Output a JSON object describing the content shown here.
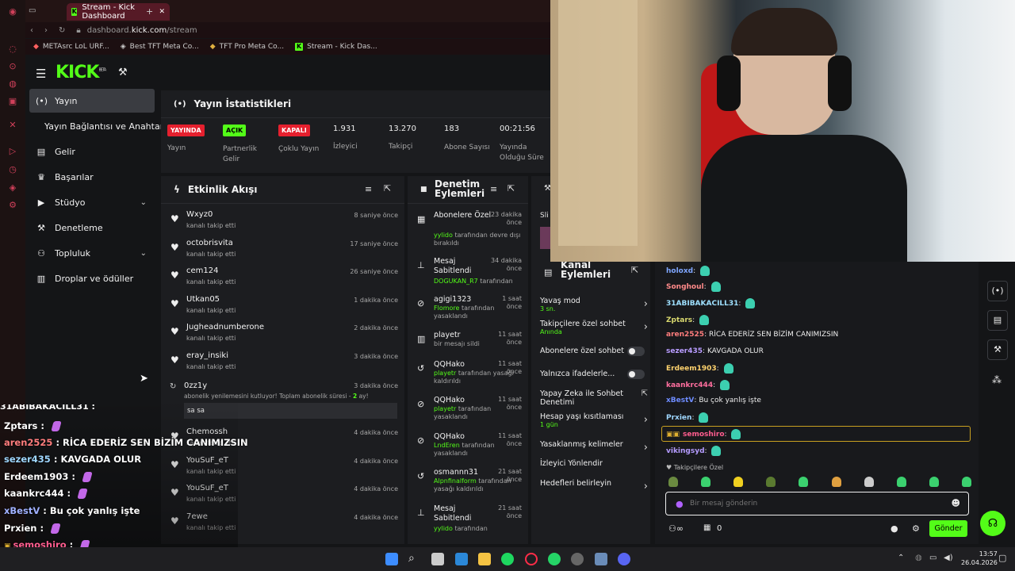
{
  "browser": {
    "tab_title": "Stream - Kick Dashboard",
    "url_prefix": "dashboard.",
    "url_host": "kick.com",
    "url_path": "/stream",
    "bookmarks": [
      "METAsrc LoL URF...",
      "Best TFT Meta Co...",
      "TFT Pro Meta Co...",
      "Stream - Kick Das..."
    ]
  },
  "header": {
    "logo": "KICK",
    "beta": "BETA"
  },
  "sidebar": {
    "items": [
      {
        "label": "Yayın",
        "icon": "broadcast-icon"
      },
      {
        "label": "Yayın Bağlantısı ve Anahtarı",
        "icon": ""
      },
      {
        "label": "Gelir",
        "icon": "coins-icon"
      },
      {
        "label": "Başarılar",
        "icon": "trophy-icon"
      },
      {
        "label": "Stüdyo",
        "icon": "camera-icon"
      },
      {
        "label": "Denetleme",
        "icon": "hammer-icon"
      },
      {
        "label": "Topluluk",
        "icon": "people-icon"
      },
      {
        "label": "Droplar ve ödüller",
        "icon": "drops-icon"
      }
    ]
  },
  "stats": {
    "title": "Yayın İstatistikleri",
    "items": [
      {
        "badge": "YAYINDA",
        "label": "Yayın"
      },
      {
        "badge": "AÇIK",
        "label": "Partnerlik Gelir Programı"
      },
      {
        "badge": "KAPALI",
        "label": "Çoklu Yayın"
      },
      {
        "value": "1.931",
        "label": "İzleyici"
      },
      {
        "value": "13.270",
        "label": "Takipçi"
      },
      {
        "value": "183",
        "label": "Abone Sayısı"
      },
      {
        "value": "00:21:56",
        "label": "Yayında Olduğu Süre"
      }
    ]
  },
  "activity": {
    "title": "Etkinlik Akışı",
    "events": [
      {
        "user": "Wxyz0",
        "sub": "kanalı takip etti",
        "time": "8 saniye önce"
      },
      {
        "user": "octobrisvita",
        "sub": "kanalı takip etti",
        "time": "17 saniye önce"
      },
      {
        "user": "cem124",
        "sub": "kanalı takip etti",
        "time": "26 saniye önce"
      },
      {
        "user": "Utkan05",
        "sub": "kanalı takip etti",
        "time": "1 dakika önce"
      },
      {
        "user": "Jugheadnumberone",
        "sub": "kanalı takip etti",
        "time": "2 dakika önce"
      },
      {
        "user": "eray_insiki",
        "sub": "kanalı takip etti",
        "time": "3 dakika önce"
      },
      {
        "user": "Chemossh",
        "sub": "kanalı takip etti",
        "time": "4 dakika önce"
      },
      {
        "user": "YouSuF_eT",
        "sub": "kanalı takip etti",
        "time": "4 dakika önce"
      },
      {
        "user": "YouSuF_eT",
        "sub": "kanalı takip etti",
        "time": "4 dakika önce"
      },
      {
        "user": "7ewe",
        "sub": "kanalı takip etti",
        "time": "4 dakika önce"
      }
    ],
    "sub_event": {
      "user": "0zz1y",
      "text_before": "abonelik yenilemesini kutluyor! Toplam abonelik süresi - ",
      "months": "2",
      "text_after": " ay!",
      "time": "3 dakika önce",
      "message": "sa sa"
    }
  },
  "moderation": {
    "title": "Denetim Eylemleri",
    "actions": [
      {
        "action": "Abonelere Özel",
        "name": "yylido",
        "detail": "tarafından devre dışı bırakıldı",
        "time": "23 dakika önce"
      },
      {
        "action": "Mesaj Sabitlendi",
        "name": "DOGUKAN_R7",
        "detail": "tarafından",
        "time": "34 dakika önce"
      },
      {
        "action": "agigi1323",
        "name": "Flomore",
        "detail": "tarafından yasaklandı",
        "time": "1 saat önce"
      },
      {
        "action": "playetr",
        "name": "",
        "detail": "bir mesajı sildi",
        "time": "11 saat önce"
      },
      {
        "action": "QQHako",
        "name": "playetr",
        "detail": "tarafından yasağı kaldırıldı",
        "time": "11 saat önce"
      },
      {
        "action": "QQHako",
        "name": "playetr",
        "detail": "tarafından yasaklandı",
        "time": "11 saat önce"
      },
      {
        "action": "QQHako",
        "name": "LndEren",
        "detail": "tarafından yasaklandı",
        "time": "11 saat önce"
      },
      {
        "action": "osmannn31",
        "name": "Alpnfinalform",
        "detail": "tarafından yasağı kaldırıldı",
        "time": "21 saat önce"
      },
      {
        "action": "Mesaj Sabitlendi",
        "name": "yylido",
        "detail": "tarafından",
        "time": "21 saat önce"
      }
    ]
  },
  "channel_actions": {
    "title": "Kanal Eylemleri",
    "items": [
      {
        "label": "Yavaş mod",
        "sub": "3 sn."
      },
      {
        "label": "Takipçilere özel sohbet",
        "sub": "Anında"
      },
      {
        "label": "Abonelere özel sohbet",
        "sub": ""
      },
      {
        "label": "Yalnızca ifadelerle...",
        "sub": ""
      },
      {
        "label": "Yapay Zeka ile Sohbet Denetimi",
        "sub": ""
      },
      {
        "label": "Hesap yaşı kısıtlaması",
        "sub": "1 gün"
      },
      {
        "label": "Yasaklanmış kelimeler",
        "sub": ""
      },
      {
        "label": "İzleyici Yönlendir",
        "sub": ""
      },
      {
        "label": "Hedefleri belirleyin",
        "sub": ""
      }
    ]
  },
  "side_peek": {
    "label": "Sli"
  },
  "chat": {
    "messages": [
      {
        "user": "holoxd",
        "text": "",
        "color": "#7fa6ff"
      },
      {
        "user": "Songhoul",
        "text": "",
        "color": "#ff8a8a"
      },
      {
        "user": "31ABIBAKACILL31",
        "text": "",
        "color": "#9ee0ff"
      },
      {
        "user": "Zptars",
        "text": "",
        "color": "#d9d96f"
      },
      {
        "user": "aren2525",
        "text": "RİCA EDERİZ SEN BİZİM CANIMIZSIN",
        "color": "#ff7d7d"
      },
      {
        "user": "sezer435",
        "text": "KAVGADA OLUR",
        "color": "#b89cff"
      },
      {
        "user": "Erdeem1903",
        "text": "",
        "color": "#ffd36e"
      },
      {
        "user": "kaankrc444",
        "text": "",
        "color": "#ff6e9e"
      },
      {
        "user": "xBestV",
        "text": "Bu çok yanlış işte",
        "color": "#6e8cff"
      },
      {
        "user": "Prxien",
        "text": "",
        "color": "#9fd7ff"
      },
      {
        "user": "semoshiro",
        "text": "",
        "color": "#ff5d8f"
      },
      {
        "user": "vikingsyd",
        "text": "",
        "color": "#b59cff"
      }
    ],
    "followers_only": "Takipçilere Özel",
    "input_placeholder": "Bir mesaj gönderin",
    "send_label": "Gönder",
    "points": "0"
  },
  "overlay_chat": [
    {
      "user": "Zptars",
      "text": "",
      "color": "#ffffff"
    },
    {
      "user": "aren2525",
      "text": "RİCA EDERİZ SEN BİZİM CANIMIZSIN",
      "color": "#ff7d7d"
    },
    {
      "user": "sezer435",
      "text": "KAVGADA OLUR",
      "color": "#9fd7ff"
    },
    {
      "user": "Erdeem1903",
      "text": "",
      "color": "#ffffff"
    },
    {
      "user": "kaankrc444",
      "text": "",
      "color": "#ffffff"
    },
    {
      "user": "xBestV",
      "text": "Bu çok yanlış işte",
      "color": "#9fb0ff"
    },
    {
      "user": "Prxien",
      "text": "",
      "color": "#ffffff"
    },
    {
      "user": "semoshiro",
      "text": "",
      "color": "#ff5d8f"
    },
    {
      "user": "vikingsyd",
      "text": "",
      "color": "#888888"
    }
  ],
  "taskbar": {
    "time": "13:57",
    "date": "26.04.2026"
  },
  "colors": {
    "accent": "#53fc18",
    "live": "#e5202e"
  }
}
